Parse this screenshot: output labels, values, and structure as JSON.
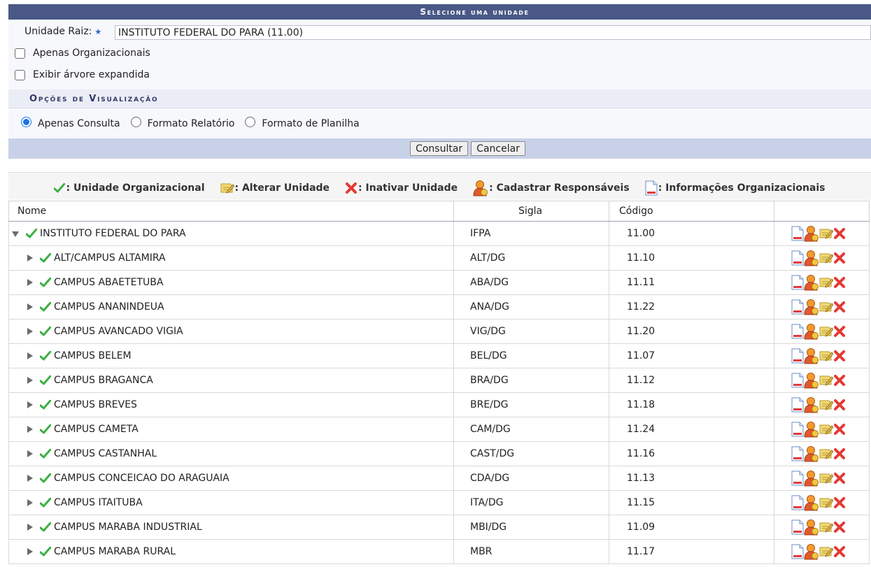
{
  "header": {
    "title": "Selecione uma unidade"
  },
  "form": {
    "raiz_label": "Unidade Raiz:",
    "raiz_value": "INSTITUTO FEDERAL DO PARA (11.00)",
    "apenas_org_label": "Apenas Organizacionais",
    "exibir_arvore_label": "Exibir árvore expandida"
  },
  "options": {
    "header": "Opções de Visualização",
    "radios": [
      "Apenas Consulta",
      "Formato Relatório",
      "Formato de Planilha"
    ],
    "selected": "Apenas Consulta"
  },
  "buttons": {
    "consultar": "Consultar",
    "cancelar": "Cancelar"
  },
  "legend": {
    "unidade_org": ": Unidade Organizacional",
    "alterar": ": Alterar Unidade",
    "inativar": ": Inativar Unidade",
    "responsaveis": ": Cadastrar Responsáveis",
    "informacoes": ": Informações Organizacionais"
  },
  "table": {
    "headers": {
      "nome": "Nome",
      "sigla": "Sigla",
      "codigo": "Código"
    },
    "rows": [
      {
        "nome": "INSTITUTO FEDERAL DO PARA",
        "sigla": "IFPA",
        "codigo": "11.00",
        "level": 0,
        "expanded": true
      },
      {
        "nome": "ALT/CAMPUS ALTAMIRA",
        "sigla": "ALT/DG",
        "codigo": "11.10",
        "level": 1,
        "expanded": false
      },
      {
        "nome": "CAMPUS ABAETETUBA",
        "sigla": "ABA/DG",
        "codigo": "11.11",
        "level": 1,
        "expanded": false
      },
      {
        "nome": "CAMPUS ANANINDEUA",
        "sigla": "ANA/DG",
        "codigo": "11.22",
        "level": 1,
        "expanded": false
      },
      {
        "nome": "CAMPUS AVANCADO VIGIA",
        "sigla": "VIG/DG",
        "codigo": "11.20",
        "level": 1,
        "expanded": false
      },
      {
        "nome": "CAMPUS BELEM",
        "sigla": "BEL/DG",
        "codigo": "11.07",
        "level": 1,
        "expanded": false
      },
      {
        "nome": "CAMPUS BRAGANCA",
        "sigla": "BRA/DG",
        "codigo": "11.12",
        "level": 1,
        "expanded": false
      },
      {
        "nome": "CAMPUS BREVES",
        "sigla": "BRE/DG",
        "codigo": "11.18",
        "level": 1,
        "expanded": false
      },
      {
        "nome": "CAMPUS CAMETA",
        "sigla": "CAM/DG",
        "codigo": "11.24",
        "level": 1,
        "expanded": false
      },
      {
        "nome": "CAMPUS CASTANHAL",
        "sigla": "CAST/DG",
        "codigo": "11.16",
        "level": 1,
        "expanded": false
      },
      {
        "nome": "CAMPUS CONCEICAO DO ARAGUAIA",
        "sigla": "CDA/DG",
        "codigo": "11.13",
        "level": 1,
        "expanded": false
      },
      {
        "nome": "CAMPUS ITAITUBA",
        "sigla": "ITA/DG",
        "codigo": "11.15",
        "level": 1,
        "expanded": false
      },
      {
        "nome": "CAMPUS MARABA INDUSTRIAL",
        "sigla": "MBI/DG",
        "codigo": "11.09",
        "level": 1,
        "expanded": false
      },
      {
        "nome": "CAMPUS MARABA RURAL",
        "sigla": "MBR",
        "codigo": "11.17",
        "level": 1,
        "expanded": false
      }
    ]
  },
  "colors": {
    "title_bar": "#4a5887",
    "button_bar": "#c8d1e8",
    "check_green": "#3cb043",
    "delete_red": "#e53935"
  },
  "icons": {
    "unidade_org": "check-icon",
    "alterar": "edit-note-icon",
    "inativar": "delete-x-icon",
    "responsaveis": "user-add-icon",
    "informacoes": "document-icon"
  }
}
